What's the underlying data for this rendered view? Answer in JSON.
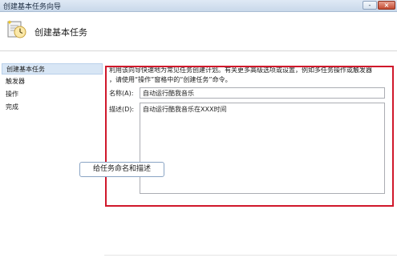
{
  "window": {
    "title": "创建基本任务向导",
    "controls": {
      "minimize": "-",
      "close": "×"
    }
  },
  "header": {
    "icon": "task-wizard-icon",
    "title": "创建基本任务"
  },
  "sidebar": {
    "items": [
      {
        "label": "创建基本任务",
        "active": true
      },
      {
        "label": "触发器",
        "active": false
      },
      {
        "label": "操作",
        "active": false
      },
      {
        "label": "完成",
        "active": false
      }
    ]
  },
  "main": {
    "intro_line1": "利用该向导快速地为常见任务创建计划。有关更多高级选项或设置，例如多任务操作或触发器",
    "intro_line2": "，请使用“操作”窗格中的“创建任务”命令。",
    "name_label": "名称(A):",
    "name_value": "自动运行酷我音乐",
    "desc_label": "描述(D):",
    "desc_value": "自动运行酷我音乐在XXX时间"
  },
  "annotation": {
    "callout_text": "给任务命名和描述",
    "highlight_color": "#d0182b"
  }
}
